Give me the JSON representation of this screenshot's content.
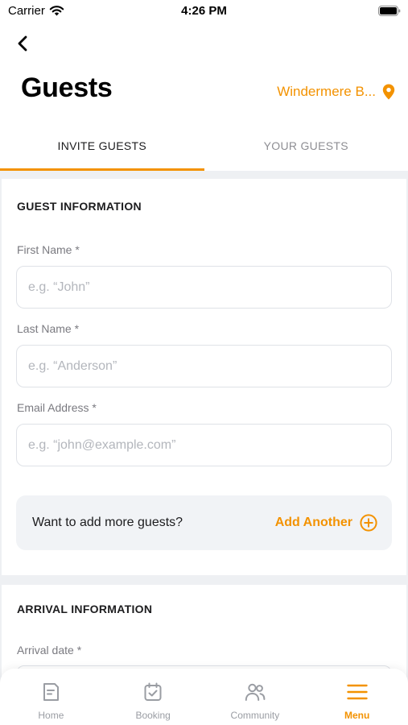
{
  "status_bar": {
    "carrier": "Carrier",
    "time": "4:26 PM"
  },
  "header": {
    "title": "Guests",
    "location": "Windermere B...",
    "back_icon": "chevron-left-icon",
    "location_icon": "map-pin-icon"
  },
  "tabs": [
    {
      "label": "INVITE GUESTS",
      "active": true
    },
    {
      "label": "YOUR GUESTS",
      "active": false
    }
  ],
  "guest_section": {
    "heading": "GUEST INFORMATION",
    "fields": [
      {
        "label": "First Name *",
        "value": "",
        "placeholder": "e.g. “John”"
      },
      {
        "label": "Last Name *",
        "value": "",
        "placeholder": "e.g. “Anderson”"
      },
      {
        "label": "Email Address *",
        "value": "",
        "placeholder": "e.g. “john@example.com”"
      }
    ],
    "add_more": {
      "prompt": "Want to add more guests?",
      "button_label": "Add Another",
      "icon": "plus-circle-icon"
    }
  },
  "arrival_section": {
    "heading": "ARRIVAL INFORMATION",
    "fields": [
      {
        "label": "Arrival date *",
        "value": "",
        "placeholder": ""
      }
    ]
  },
  "bottom_nav": [
    {
      "label": "Home",
      "icon": "home-document-icon",
      "active": false
    },
    {
      "label": "Booking",
      "icon": "calendar-check-icon",
      "active": false
    },
    {
      "label": "Community",
      "icon": "people-icon",
      "active": false
    },
    {
      "label": "Menu",
      "icon": "hamburger-menu-icon",
      "active": true
    }
  ],
  "colors": {
    "accent": "#f39200",
    "background": "#eef0f3",
    "text": "#1c1c1e",
    "muted": "#9a9da3"
  }
}
